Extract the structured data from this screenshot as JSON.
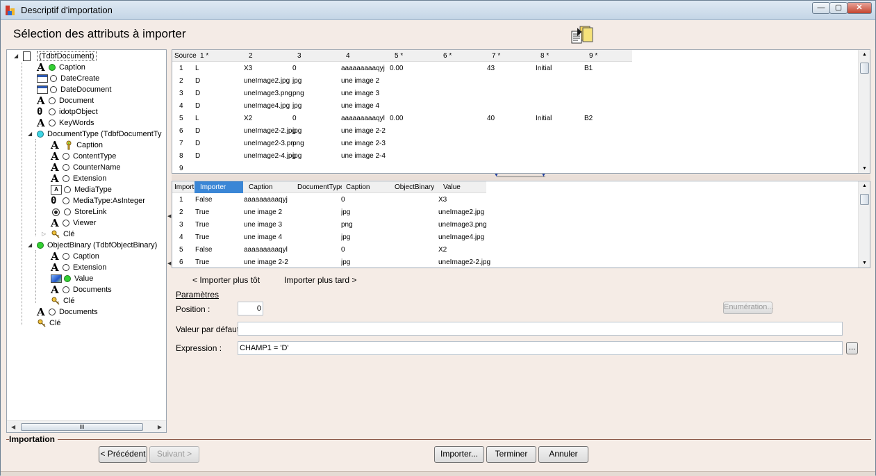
{
  "window": {
    "title": "Descriptif d'importation",
    "controls": [
      "—",
      "▢",
      "✕"
    ]
  },
  "header": {
    "title": "Sélection des attributs à importer",
    "icon": "import-wizard-icon"
  },
  "tree": {
    "items": [
      {
        "label": "(TdbfDocument)",
        "icon": "document-icon",
        "marker": "none",
        "expanded": true
      },
      {
        "label": "Caption",
        "icon": "text-A-icon",
        "marker": "green"
      },
      {
        "label": "DateCreate",
        "icon": "date-icon",
        "marker": "empty"
      },
      {
        "label": "DateDocument",
        "icon": "date-icon",
        "marker": "empty"
      },
      {
        "label": "Document",
        "icon": "text-A-icon",
        "marker": "empty"
      },
      {
        "label": "idotpObject",
        "icon": "number-0-icon",
        "marker": "empty"
      },
      {
        "label": "KeyWords",
        "icon": "text-A-icon",
        "marker": "empty"
      },
      {
        "label": "DocumentType (TdbfDocumentTy",
        "icon": "none",
        "marker": "cyan",
        "expanded": true
      },
      {
        "label": "Caption",
        "icon": "text-A-icon",
        "marker": "key"
      },
      {
        "label": "ContentType",
        "icon": "text-A-icon",
        "marker": "empty"
      },
      {
        "label": "CounterName",
        "icon": "text-A-icon",
        "marker": "empty"
      },
      {
        "label": "Extension",
        "icon": "text-A-icon",
        "marker": "empty"
      },
      {
        "label": "MediaType",
        "icon": "media-type-icon",
        "marker": "empty"
      },
      {
        "label": "MediaType:AsInteger",
        "icon": "number-0-icon",
        "marker": "empty"
      },
      {
        "label": "StoreLink",
        "icon": "radio-icon",
        "marker": "empty"
      },
      {
        "label": "Viewer",
        "icon": "text-A-icon",
        "marker": "empty"
      },
      {
        "label": "Clé",
        "icon": "key-icon",
        "marker": "none",
        "collapsed": true
      },
      {
        "label": "ObjectBinary (TdbfObjectBinary)",
        "icon": "none",
        "marker": "green",
        "expanded": true
      },
      {
        "label": "Caption",
        "icon": "text-A-icon",
        "marker": "empty"
      },
      {
        "label": "Extension",
        "icon": "text-A-icon",
        "marker": "empty"
      },
      {
        "label": "Value",
        "icon": "image-icon",
        "marker": "green"
      },
      {
        "label": "Documents",
        "icon": "text-A-icon",
        "marker": "empty"
      },
      {
        "label": "Clé",
        "icon": "key-icon",
        "marker": "none"
      },
      {
        "label": "Documents",
        "icon": "text-A-icon",
        "marker": "empty"
      },
      {
        "label": "Clé",
        "icon": "key-icon",
        "marker": "none"
      }
    ],
    "hscroll_thumb": "III"
  },
  "source_grid": {
    "headers": [
      "Source",
      "1 *",
      "2",
      "3",
      "4",
      "5 *",
      "6 *",
      "7 *",
      "8 *",
      "9 *"
    ],
    "rows": [
      [
        "1",
        "L",
        "X3",
        "0",
        "aaaaaaaaaqyj",
        "0.00",
        "",
        "43",
        "Initial",
        "B1"
      ],
      [
        "2",
        "D",
        "uneImage2.jpg",
        "jpg",
        "une image 2",
        "",
        "",
        "",
        "",
        ""
      ],
      [
        "3",
        "D",
        "uneImage3.png",
        "png",
        "une image 3",
        "",
        "",
        "",
        "",
        ""
      ],
      [
        "4",
        "D",
        "uneImage4.jpg",
        "jpg",
        "une image 4",
        "",
        "",
        "",
        "",
        ""
      ],
      [
        "5",
        "L",
        "X2",
        "0",
        "aaaaaaaaaqyl",
        "0.00",
        "",
        "40",
        "Initial",
        "B2"
      ],
      [
        "6",
        "D",
        "uneImage2-2.jpg",
        "jpg",
        "une image 2-2",
        "",
        "",
        "",
        "",
        ""
      ],
      [
        "7",
        "D",
        "uneImage2-3.pn",
        "png",
        "une image 2-3",
        "",
        "",
        "",
        "",
        ""
      ],
      [
        "8",
        "D",
        "uneImage2-4.jpg",
        "jpg",
        "une image 2-4",
        "",
        "",
        "",
        "",
        ""
      ],
      [
        "9",
        "",
        "",
        "",
        "",
        "",
        "",
        "",
        "",
        ""
      ]
    ]
  },
  "import_grid": {
    "headers": [
      "Import",
      "Importer",
      "Caption",
      "DocumentType",
      "Caption",
      "ObjectBinary",
      "Value"
    ],
    "rows": [
      [
        "1",
        "False",
        "aaaaaaaaaqyj",
        "",
        "0",
        "",
        "X3"
      ],
      [
        "2",
        "True",
        "une image 2",
        "",
        "jpg",
        "",
        "uneImage2.jpg"
      ],
      [
        "3",
        "True",
        "une image 3",
        "",
        "png",
        "",
        "uneImage3.png"
      ],
      [
        "4",
        "True",
        "une image 4",
        "",
        "jpg",
        "",
        "uneImage4.jpg"
      ],
      [
        "5",
        "False",
        "aaaaaaaaaqyl",
        "",
        "0",
        "",
        "X2"
      ],
      [
        "6",
        "True",
        "une image 2-2",
        "",
        "jpg",
        "",
        "uneImage2-2.jpg"
      ]
    ]
  },
  "links": {
    "earlier": "< Importer plus tôt",
    "later": "Importer plus tard >"
  },
  "params": {
    "section": "Paramètres",
    "position_label": "Position :",
    "position_value": "0",
    "enum_button": "Enumération...",
    "default_label": "Valeur par défaut :",
    "default_value": "",
    "expr_label": "Expression :",
    "expr_value": "CHAMP1 = 'D'",
    "expr_button": "..."
  },
  "footer": {
    "group": "Importation",
    "prev": "< Précédent",
    "next": "Suivant >",
    "import": "Importer...",
    "finish": "Terminer",
    "cancel": "Annuler"
  }
}
